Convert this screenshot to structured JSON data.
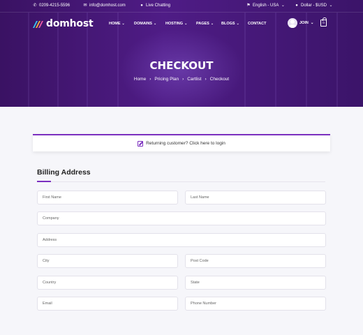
{
  "topbar": {
    "phone": "0209-4215-5596",
    "email": "info@domhost.com",
    "chat": "Live Chatting",
    "language": "English - USA",
    "currency": "Dollar - $USD"
  },
  "brand": {
    "name": "domhost"
  },
  "nav": {
    "items": [
      {
        "label": "HOME"
      },
      {
        "label": "DOMAINS"
      },
      {
        "label": "HOSTING"
      },
      {
        "label": "PAGES"
      },
      {
        "label": "BLOGS"
      },
      {
        "label": "CONTACT"
      }
    ],
    "join": "JOIN",
    "cart_count": "0"
  },
  "hero": {
    "title": "CHECKOUT",
    "breadcrumb": [
      "Home",
      "Pricing Plan",
      "Cartlist",
      "Checkout"
    ]
  },
  "login_prompt": "Returning customer? Click here to login",
  "billing": {
    "title": "Billing Address",
    "fields": {
      "first_name": "First Name",
      "last_name": "Last Name",
      "company": "Company",
      "address": "Address",
      "city": "City",
      "post_code": "Post Code",
      "country": "Country",
      "state": "State",
      "email": "Email",
      "phone": "Phone Number"
    }
  },
  "colors": {
    "accent": "#7b2fbf",
    "hero_bg": "#4f1c86",
    "page_bg": "#f6f6fa"
  }
}
